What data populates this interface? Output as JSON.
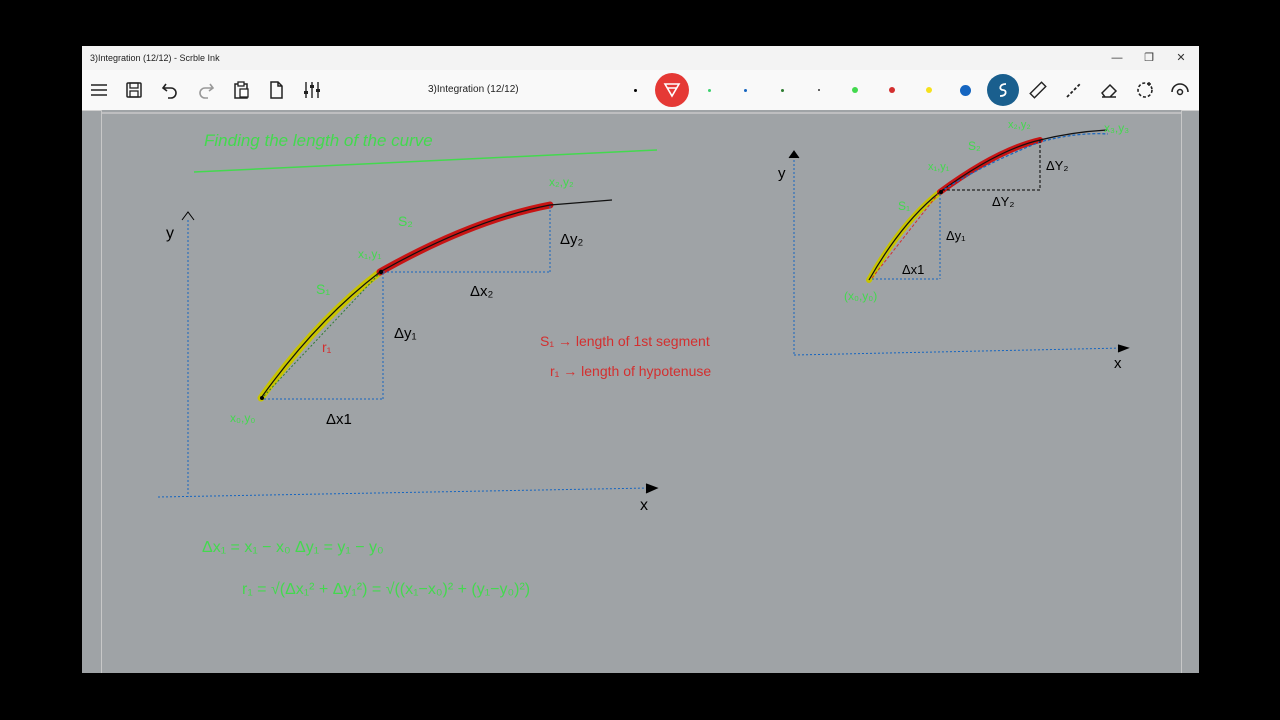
{
  "window": {
    "title": "3)Integration (12/12) - Scrble Ink",
    "controls": {
      "minimize": "—",
      "restore": "❐",
      "close": "✕"
    }
  },
  "toolbar": {
    "doc_title": "3)Integration (12/12)",
    "icons": [
      "menu-icon",
      "save-icon",
      "undo-icon",
      "redo-icon",
      "paste-icon",
      "page-icon",
      "settings-sliders-icon"
    ],
    "pens": [
      {
        "color": "#000000",
        "size": 2
      },
      {
        "color": "#e53935",
        "size": 30,
        "selected": true
      },
      {
        "color": "#3cd16e",
        "size": 2
      },
      {
        "color": "#1565c0",
        "size": 2
      },
      {
        "color": "#2e7d32",
        "size": 2
      },
      {
        "color": "#333333",
        "size": 1
      },
      {
        "color": "#43d94e",
        "size": 6
      },
      {
        "color": "#d32f2f",
        "size": 6
      },
      {
        "color": "#f6e11c",
        "size": 6
      },
      {
        "color": "#1565c0",
        "size": 10
      }
    ],
    "tools": [
      "smooth-pen-icon",
      "ruler-icon",
      "dashed-line-icon",
      "eraser-icon",
      "lasso-icon",
      "view-icon"
    ]
  },
  "canvas": {
    "annotations": {
      "heading": "Finding the length of the curve",
      "l_y": "y",
      "l_x": "x",
      "l_x0y0": "x₀,y₀",
      "l_x1y1": "x₁,y₁",
      "l_x2y2": "x₂,y₂",
      "l_s1": "S₁",
      "l_s2": "S₂",
      "l_r1": "r₁",
      "l_dx1": "Δx1",
      "l_dy1": "Δy₁",
      "l_dx2": "Δx₂",
      "l_dy2": "Δy₂",
      "def1": "S₁ → length of 1st segment",
      "def2": "r₁ → length of hypotenuse",
      "eq1": "Δx₁ = x₁ − x₀    Δy₁ = y₁ − y₀",
      "eq2": "r₁ = √(Δx₁² + Δy₁²) = √((x₁−x₀)² + (y₁−y₀)²)",
      "r_y": "y",
      "r_x": "x",
      "r_x0y0": "(x₀,y₀)",
      "r_x1y1": "x₁,y₁",
      "r_x2y2": "x₂,y₂",
      "r_x3y3": "x₃,y₃",
      "r_s1": "S₁",
      "r_s2": "S₂",
      "r_dx1": "Δx1",
      "r_dy1": "Δy₁",
      "r_dx2": "ΔY₂",
      "r_dy2": "ΔY₂"
    }
  }
}
